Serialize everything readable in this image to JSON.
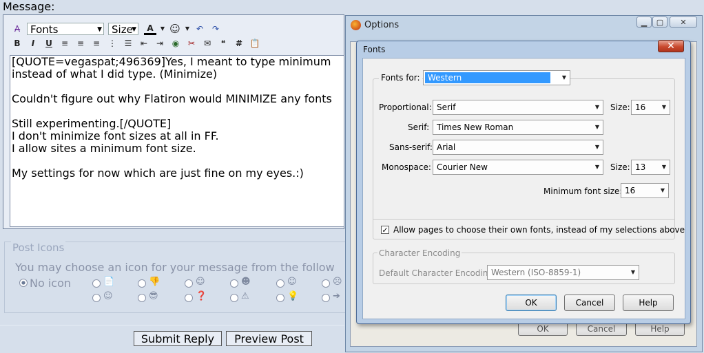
{
  "forum": {
    "message_label": "Message:",
    "toolbar": {
      "font_select": "Fonts",
      "size_select": "Size"
    },
    "message_lines": [
      "[QUOTE=vegaspat;496369]Yes, I meant to type minimum",
      "instead of what I did type. (Minimize)",
      "",
      "Couldn't figure out why Flatiron would MINIMIZE any fonts",
      "",
      "Still experimenting.[/QUOTE]",
      "I don't minimize font sizes at all in FF.",
      "I allow sites a minimum font size.",
      "",
      "My settings for now which are just fine on my eyes.:)"
    ],
    "post_icons": {
      "legend": "Post Icons",
      "description": "You may choose an icon for your message from the follow",
      "no_icon_label": "No icon"
    },
    "submit_label": "Submit Reply",
    "preview_label": "Preview Post"
  },
  "options_window": {
    "title": "Options",
    "footer_buttons": [
      "OK",
      "Cancel",
      "Help"
    ]
  },
  "fonts_dialog": {
    "title": "Fonts",
    "fonts_for_label": "Fonts for:",
    "fonts_for_value": "Western",
    "proportional_label": "Proportional:",
    "proportional_value": "Serif",
    "proportional_size_label": "Size:",
    "proportional_size_value": "16",
    "serif_label": "Serif:",
    "serif_value": "Times New Roman",
    "sans_serif_label": "Sans-serif:",
    "sans_serif_value": "Arial",
    "monospace_label": "Monospace:",
    "monospace_value": "Courier New",
    "monospace_size_label": "Size:",
    "monospace_size_value": "13",
    "min_font_size_label": "Minimum font size:",
    "min_font_size_value": "16",
    "allow_pages_label": "Allow pages to choose their own fonts, instead of my selections above",
    "allow_pages_checked": true,
    "char_encoding_legend": "Character Encoding",
    "default_encoding_label": "Default Character Encoding:",
    "default_encoding_value": "Western (ISO-8859-1)",
    "ok_label": "OK",
    "cancel_label": "Cancel",
    "help_label": "Help"
  },
  "colors": {
    "selection": "#3399ff",
    "close_button": "#c94a2f",
    "page_background": "#d6dfeb"
  }
}
